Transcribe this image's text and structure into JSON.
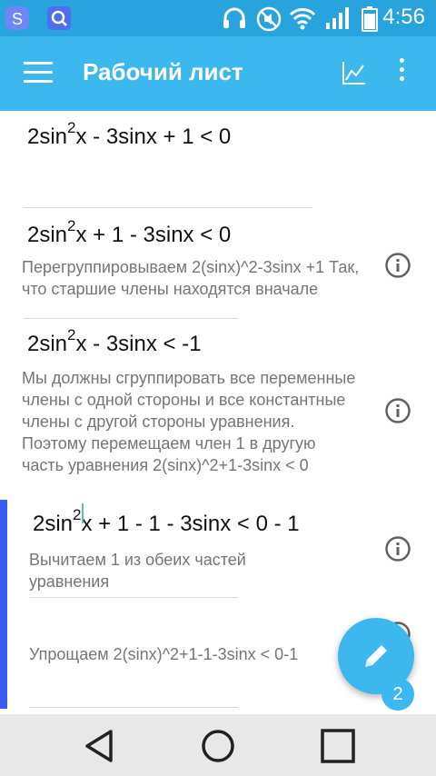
{
  "status_bar": {
    "time": "4:56",
    "icons": [
      "s-app-icon",
      "search-app-icon",
      "headphones-icon",
      "mute-icon",
      "wifi-icon",
      "signal-icon",
      "battery-icon"
    ]
  },
  "app_bar": {
    "title": "Рабочий лист",
    "icons": [
      "menu-icon",
      "graph-icon",
      "more-vert-icon"
    ]
  },
  "steps": [
    {
      "math": {
        "pre": "2sin",
        "sup": "2",
        "post": "x - 3sinx + 1 < 0"
      },
      "explanation": ""
    },
    {
      "math": {
        "pre": "2sin",
        "sup": "2",
        "post": "x + 1 - 3sinx < 0"
      },
      "explanation": "Перегруппировываем 2(sinx)^2-3sinx +1 Так, что старшие члены находятся вначале"
    },
    {
      "math": {
        "pre": "2sin",
        "sup": "2",
        "post": "x - 3sinx < -1"
      },
      "explanation": "Мы должны сгруппировать все переменные члены с одной стороны и все константные члены с другой стороны уравнения. Поэтому перемещаем член 1 в другую часть уравнения 2(sinx)^2+1-3sinx < 0"
    },
    {
      "math": {
        "pre": "2sin",
        "sup": "2",
        "post": "x + 1 - 1 - 3sinx < 0 - 1"
      },
      "explanation": "Вычитаем 1 из обеих частей уравнения"
    },
    {
      "math": {
        "pre": "",
        "sup": "",
        "post": ""
      },
      "explanation": "Упрощаем 2(sinx)^2+1-1-3sinx < 0-1"
    }
  ],
  "fab": {
    "icon": "pencil-icon",
    "badge": "2"
  },
  "nav_bar": {
    "icons": [
      "back-icon",
      "home-icon",
      "recents-icon"
    ]
  },
  "colors": {
    "status_bar": "#29a3dd",
    "app_bar": "#3cb8ef",
    "accent_bar": "#3a5cf4",
    "nav_bar": "#e8e8e8"
  }
}
